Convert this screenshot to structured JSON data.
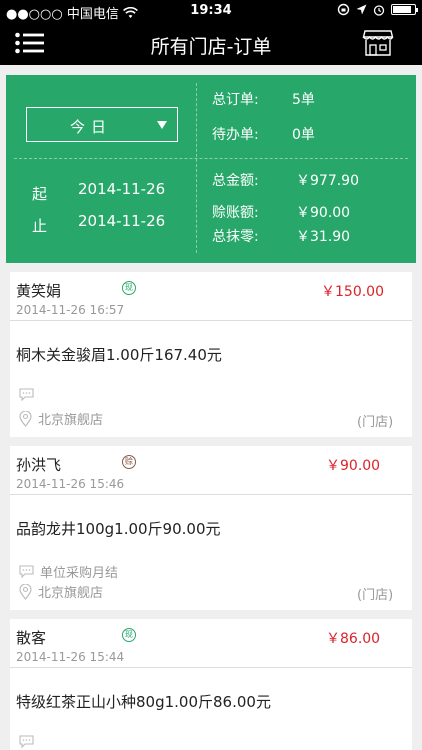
{
  "status_bar": {
    "carrier": "●●○○○ 中国电信",
    "time": "19:34",
    "battery_level": 0.85
  },
  "nav": {
    "title": "所有门店-订单",
    "menu_icon": "menu-icon",
    "store_icon": "store-icon"
  },
  "summary": {
    "period_select": "今日",
    "start_label": "起",
    "end_label": "止",
    "start_date": "2014-11-26",
    "end_date": "2014-11-26",
    "stats": [
      {
        "label": "总订单:",
        "value": "5单"
      },
      {
        "label": "待办单:",
        "value": "0单"
      },
      {
        "label": "总金额:",
        "value": "￥977.90"
      },
      {
        "label": "赊账额:",
        "value": "￥90.00"
      },
      {
        "label": "总抹零:",
        "value": "￥31.90"
      }
    ]
  },
  "orders": [
    {
      "customer": "黄笑娟",
      "status_badge": "现",
      "amount": "￥150.00",
      "time": "2014-11-26 16:57",
      "items": "桐木关金骏眉1.00斤167.40元",
      "note": "",
      "store": "北京旗舰店",
      "source": "(门店)"
    },
    {
      "customer": "孙洪飞",
      "status_badge": "赊",
      "amount": "￥90.00",
      "time": "2014-11-26 15:46",
      "items": "品韵龙井100g1.00斤90.00元",
      "note": "单位采购月结",
      "store": "北京旗舰店",
      "source": "(门店)"
    },
    {
      "customer": "散客",
      "status_badge": "现",
      "amount": "￥86.00",
      "time": "2014-11-26 15:44",
      "items": "特级红茶正山小种80g1.00斤86.00元",
      "note": "",
      "store": "",
      "source": ""
    }
  ],
  "colors": {
    "accent_green": "#27a86a",
    "amount_red": "#d9242a",
    "nav_bg": "#000000",
    "page_bg": "#efefef"
  }
}
